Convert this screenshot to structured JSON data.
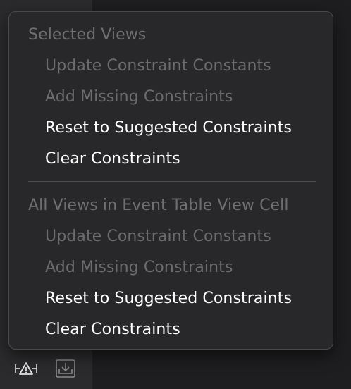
{
  "menu": {
    "sections": [
      {
        "header": "Selected Views",
        "items": [
          {
            "label": "Update Constraint Constants",
            "enabled": false
          },
          {
            "label": "Add Missing Constraints",
            "enabled": false
          },
          {
            "label": "Reset to Suggested Constraints",
            "enabled": true
          },
          {
            "label": "Clear Constraints",
            "enabled": true
          }
        ]
      },
      {
        "header": "All Views in Event Table View Cell",
        "items": [
          {
            "label": "Update Constraint Constants",
            "enabled": false
          },
          {
            "label": "Add Missing Constraints",
            "enabled": false
          },
          {
            "label": "Reset to Suggested Constraints",
            "enabled": true
          },
          {
            "label": "Clear Constraints",
            "enabled": true
          }
        ]
      }
    ]
  },
  "toolbar": {
    "icons": [
      "resolve-auto-layout-issues-icon",
      "embed-in-icon"
    ]
  }
}
